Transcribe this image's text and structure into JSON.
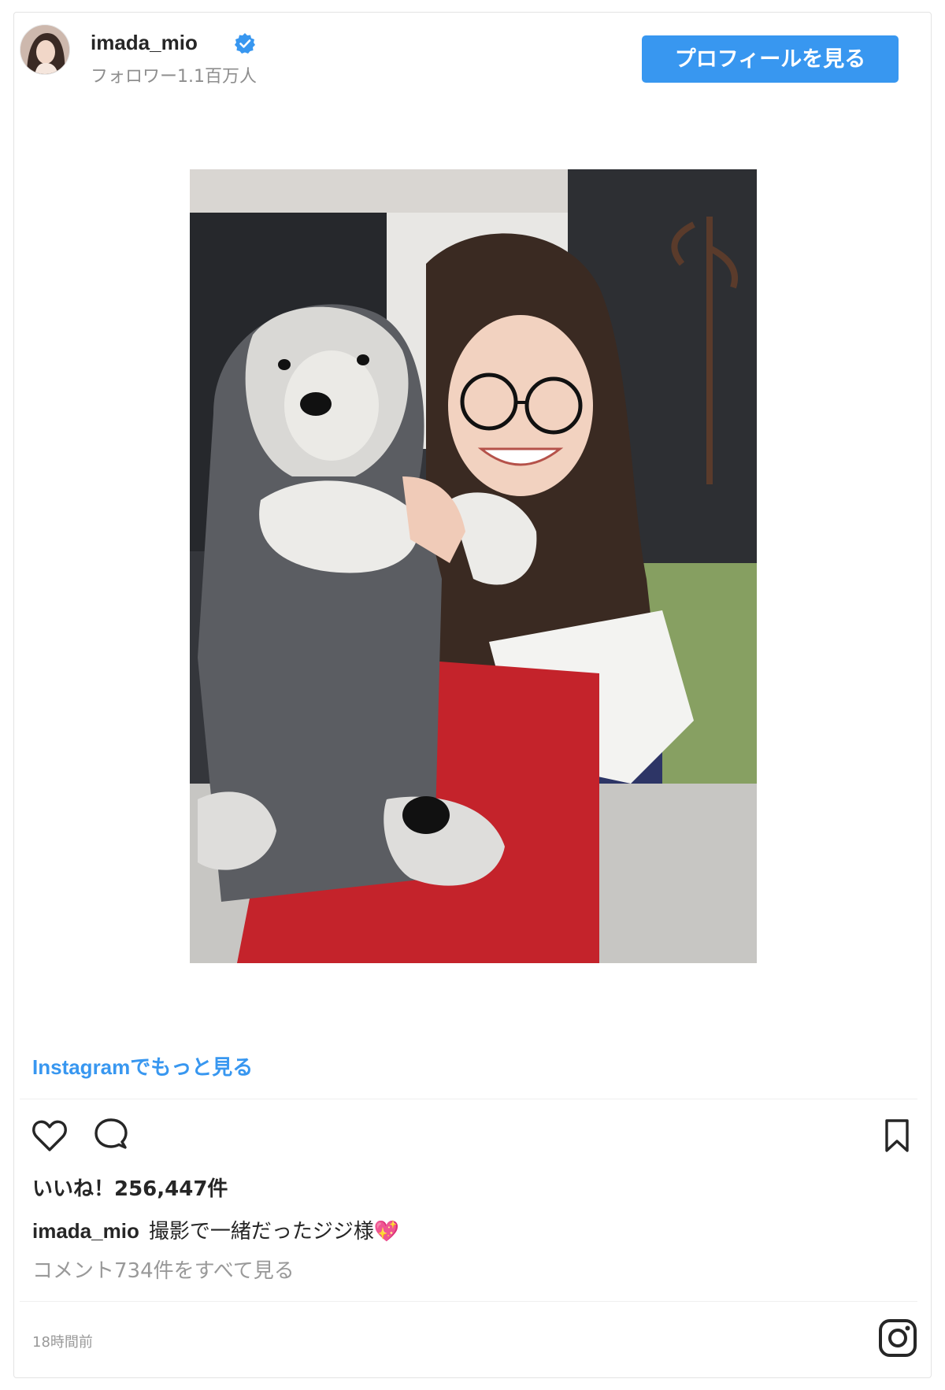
{
  "header": {
    "username": "imada_mio",
    "followers": "フォロワー1.1百万人",
    "profile_button": "プロフィールを見る"
  },
  "post": {
    "more_link": "Instagramでもっと見る",
    "likes": "いいね！256,447件",
    "caption_user": "imada_mio",
    "caption_text": "撮影で一緒だったジジ様💖",
    "comments_link": "コメント734件をすべて見る",
    "timestamp": "18時間前"
  },
  "icons": {
    "verified": "verified-badge-icon",
    "like": "heart-icon",
    "comment": "comment-bubble-icon",
    "save": "bookmark-icon",
    "instagram": "instagram-logo-icon"
  },
  "colors": {
    "accent": "#3897f0",
    "muted": "#8e8e8e",
    "text": "#262626",
    "border": "#e3e3e3"
  }
}
